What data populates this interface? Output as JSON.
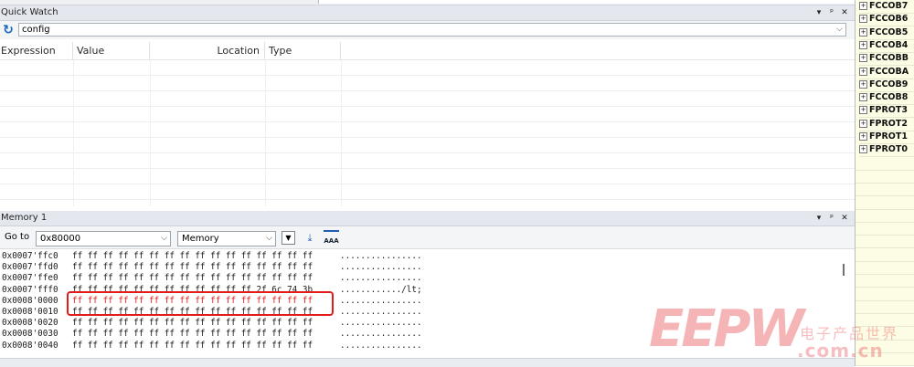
{
  "quick_watch": {
    "title": "Quick Watch",
    "controls": [
      "▾",
      "ᵖ",
      "✕"
    ],
    "expression_value": "config",
    "columns": [
      "Expression",
      "Value",
      "Location",
      "Type"
    ]
  },
  "memory": {
    "title": "Memory 1",
    "controls": [
      "▾",
      "ᵖ",
      "✕"
    ],
    "goto_label": "Go to",
    "goto_value": "0x80000",
    "view_value": "Memory",
    "rows": [
      {
        "addr": "0x0007'ffc0",
        "bytes": "ff ff ff ff ff ff ff ff ff ff ff ff ff ff ff ff",
        "ascii": "................",
        "changed": false
      },
      {
        "addr": "0x0007'ffd0",
        "bytes": "ff ff ff ff ff ff ff ff ff ff ff ff ff ff ff ff",
        "ascii": "................",
        "changed": false
      },
      {
        "addr": "0x0007'ffe0",
        "bytes": "ff ff ff ff ff ff ff ff ff ff ff ff ff ff ff ff",
        "ascii": "................",
        "changed": false
      },
      {
        "addr": "0x0007'fff0",
        "bytes": "ff ff ff ff ff ff ff ff ff ff ff ff 2f 6c 74 3b",
        "ascii": "............/lt;",
        "changed": false
      },
      {
        "addr": "0x0008'0000",
        "bytes": "ff ff ff ff ff ff ff ff ff ff ff ff ff ff ff ff",
        "ascii": "................",
        "changed": true
      },
      {
        "addr": "0x0008'0010",
        "bytes": "ff ff ff ff ff ff ff ff ff ff ff ff ff ff ff ff",
        "ascii": "................",
        "changed": false
      },
      {
        "addr": "0x0008'0020",
        "bytes": "ff ff ff ff ff ff ff ff ff ff ff ff ff ff ff ff",
        "ascii": "................",
        "changed": false
      },
      {
        "addr": "0x0008'0030",
        "bytes": "ff ff ff ff ff ff ff ff ff ff ff ff ff ff ff ff",
        "ascii": "................",
        "changed": false
      },
      {
        "addr": "0x0008'0040",
        "bytes": "ff ff ff ff ff ff ff ff ff ff ff ff ff ff ff ff",
        "ascii": "................",
        "changed": false
      }
    ]
  },
  "registers": [
    "FCCOB7",
    "FCCOB6",
    "FCCOB5",
    "FCCOB4",
    "FCCOBB",
    "FCCOBA",
    "FCCOB9",
    "FCCOB8",
    "FPROT3",
    "FPROT2",
    "FPROT1",
    "FPROT0"
  ],
  "watermark": {
    "logo": "EEPW",
    "chinese": "电子产品世界",
    "url": ".com.cn"
  },
  "colors": {
    "changed_bytes": "#e02020",
    "highlight": "#e31b1b",
    "register_bg": "#fdfde6"
  }
}
